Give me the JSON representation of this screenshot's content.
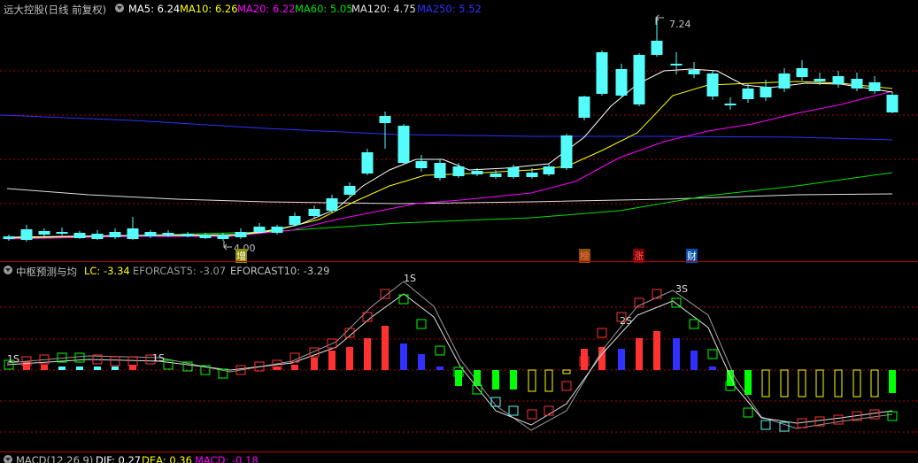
{
  "price_panel": {
    "title": "远大控股(日线 前复权)",
    "ma": [
      {
        "label": "MA5: 6.24",
        "color": "#ffffff"
      },
      {
        "label": "MA10: 6.26",
        "color": "#ffff00"
      },
      {
        "label": "MA20: 6.22",
        "color": "#ff00ff"
      },
      {
        "label": "MA60: 5.05",
        "color": "#00e000"
      },
      {
        "label": "MA120: 4.75",
        "color": "#e0e0e0"
      },
      {
        "label": "MA250: 5.52",
        "color": "#3030ff"
      }
    ],
    "high_label": "7.24",
    "low_label": "4.00",
    "markers": [
      {
        "text": "增",
        "color": "#ffffff",
        "bg": "#8c8c00"
      },
      {
        "text": "榜",
        "color": "#ff6060",
        "bg": "#8c5000"
      },
      {
        "text": "涨",
        "color": "#ff6060",
        "bg": "#7a0000"
      },
      {
        "text": "财",
        "color": "#ffffff",
        "bg": "#0050b0"
      }
    ]
  },
  "indicator_panel": {
    "title": "中枢预测与均",
    "items": [
      {
        "label": "LC: -3.34",
        "color": "#ffff00"
      },
      {
        "label": "EFORCAST5: -3.07",
        "color": "#9a9a9a"
      },
      {
        "label": "EFORCAST10: -3.29",
        "color": "#c0c0c0"
      }
    ],
    "labels": [
      "1S",
      "1S",
      "1S",
      "2S",
      "3S"
    ]
  },
  "macd_panel": {
    "title": "MACD(12,26,9)",
    "items": [
      {
        "label": "DIF: 0.27",
        "color": "#ffffff"
      },
      {
        "label": "DEA: 0.36",
        "color": "#ffff00"
      },
      {
        "label": "MACD: -0.18",
        "color": "#ff00ff"
      }
    ]
  },
  "colors": {
    "up": "#ff3232",
    "down": "#54fcfc",
    "grid": "#b40000",
    "background": "#000000"
  }
}
